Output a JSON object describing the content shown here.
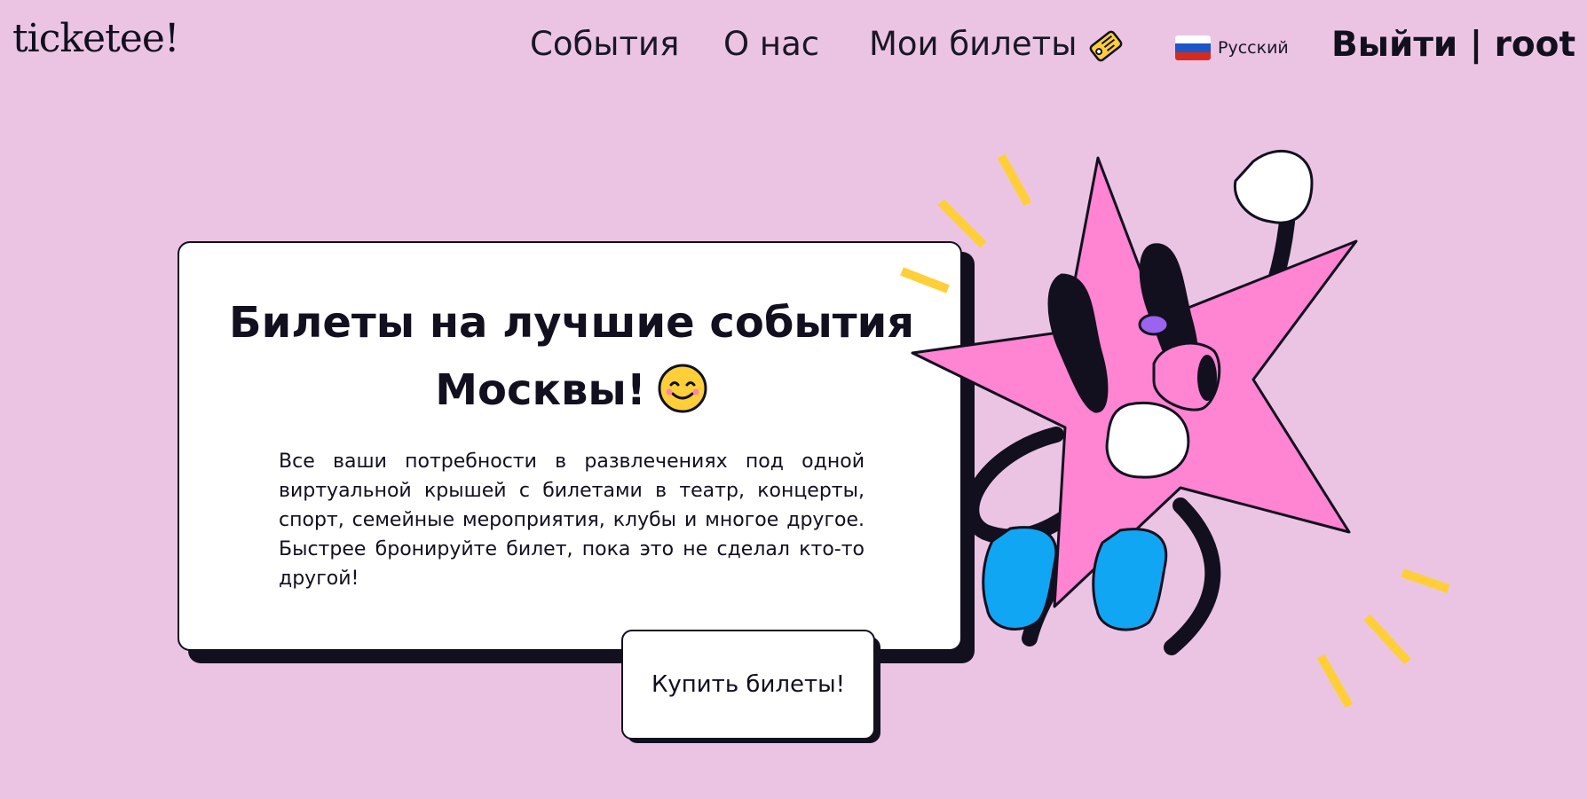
{
  "header": {
    "logo_text": "ticketee!",
    "nav": {
      "events": "События",
      "about": "О нас",
      "my_tickets": "Мои билеты"
    },
    "language": {
      "label": "Русский",
      "flag_colors": [
        "#ffffff",
        "#1c57c8",
        "#d52b1e"
      ]
    },
    "logout": "Выйти | root"
  },
  "hero": {
    "title": "Билеты на лучшие события Москвы!",
    "description": "Все ваши потребности в развлечениях под одной виртуальной крышей с билетами в театр, концерты, спорт, семейные мероприятия, клубы и многое другое. Быстрее бронируйте билет, пока это не сделал кто-то другой!",
    "cta_label": "Купить билеты!"
  },
  "colors": {
    "background": "#ebc4e4",
    "ink": "#12101f",
    "card": "#ffffff",
    "star": "#ff84d2",
    "shoe": "#11a6f3",
    "accent_yellow": "#ffcf3a"
  },
  "icons": [
    "ticket-tag-icon",
    "russia-flag-icon",
    "smiling-face-icon",
    "star-mascot-illustration"
  ]
}
